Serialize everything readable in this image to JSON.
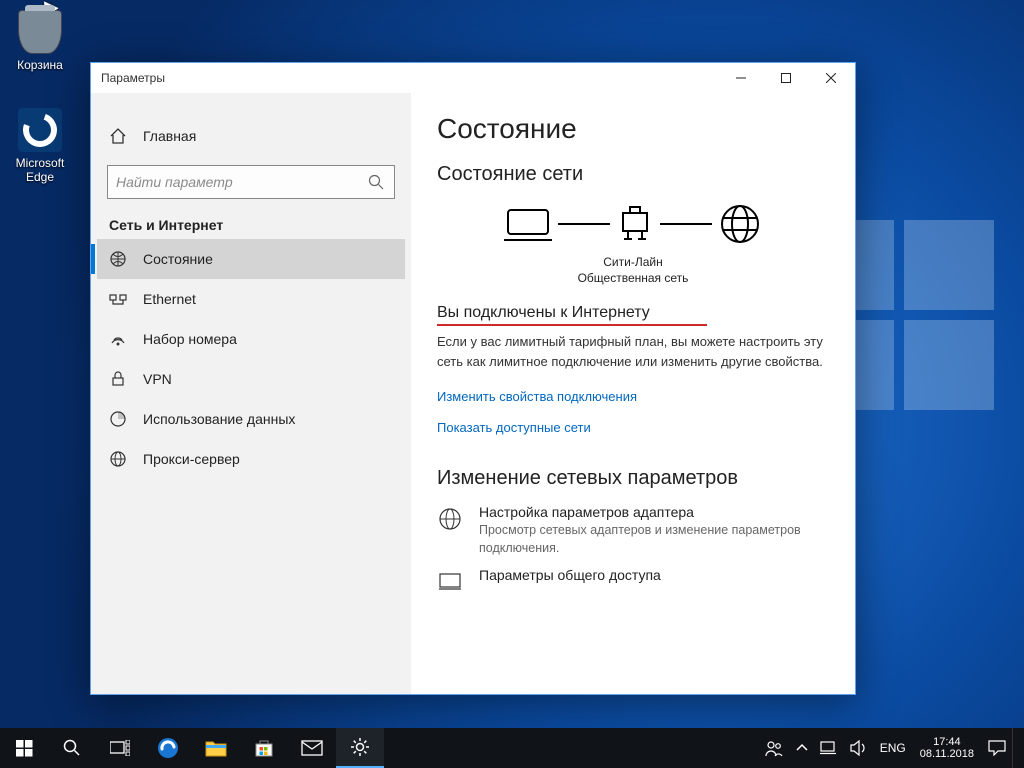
{
  "desktop_icons": {
    "recycle_bin": "Корзина",
    "edge": "Microsoft Edge"
  },
  "window": {
    "title": "Параметры"
  },
  "sidebar": {
    "home": "Главная",
    "search_placeholder": "Найти параметр",
    "category": "Сеть и Интернет",
    "items": [
      {
        "label": "Состояние"
      },
      {
        "label": "Ethernet"
      },
      {
        "label": "Набор номера"
      },
      {
        "label": "VPN"
      },
      {
        "label": "Использование данных"
      },
      {
        "label": "Прокси-сервер"
      }
    ]
  },
  "main": {
    "heading": "Состояние",
    "subheading": "Состояние сети",
    "diagram_label1": "Сити-Лайн",
    "diagram_label2": "Общественная сеть",
    "status_title": "Вы подключены к Интернету",
    "status_body": "Если у вас лимитный тарифный план, вы можете настроить эту сеть как лимитное подключение или изменить другие свойства.",
    "link1": "Изменить свойства подключения",
    "link2": "Показать доступные сети",
    "change_heading": "Изменение сетевых параметров",
    "adapter_title": "Настройка параметров адаптера",
    "adapter_desc": "Просмотр сетевых адаптеров и изменение параметров подключения.",
    "sharing_title": "Параметры общего доступа"
  },
  "tray": {
    "lang": "ENG",
    "time": "17:44",
    "date": "08.11.2018"
  }
}
